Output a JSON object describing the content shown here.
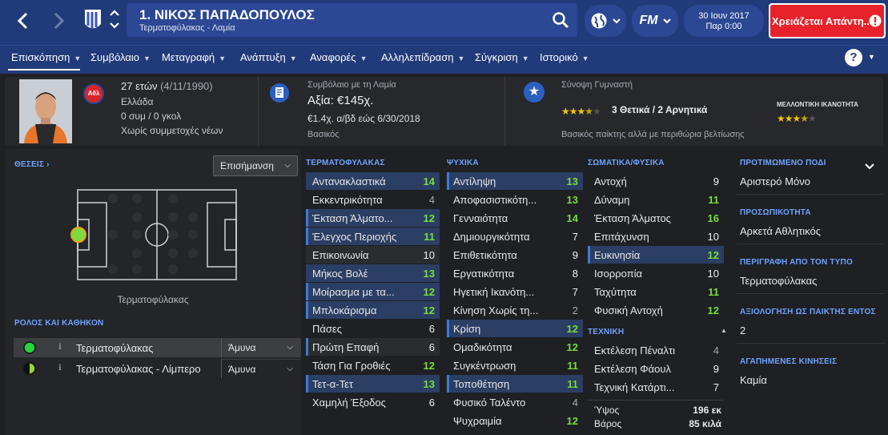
{
  "header": {
    "player_name": "1. ΝΙΚΟΣ ΠΑΠΑΔΟΠΟΥΛΟΣ",
    "subtitle": "Τερματοφύλακας - Λαμία",
    "date": "30 Ιουν 2017",
    "time": "Παρ 0:00",
    "alert": "Χρειάζεται Απάντη...",
    "fm": "FM"
  },
  "tabs": [
    "Επισκόπηση",
    "Συμβόλαιο",
    "Μεταγραφή",
    "Ανάπτυξη",
    "Αναφορές",
    "Αλληλεπίδραση",
    "Σύγκριση",
    "Ιστορικό"
  ],
  "summary": {
    "age": "27 ετών",
    "dob": "(4/11/1990)",
    "nation": "Ελλάδα",
    "caps": "0 συμ / 0 γκολ",
    "youth": "Χωρίς συμμετοχές νέων",
    "club_badge": "Αθλ",
    "contract_label": "Συμβόλαιο με τη Λαμία",
    "value": "Αξία: €145χ.",
    "wage": "€1.4χ. α/βδ εώς 6/30/2018",
    "contract_type": "Βασικός",
    "coach_label": "Σύνοψη Γυμναστή",
    "coach_summary": "3 Θετικά / 2 Αρνητικά",
    "coach_desc": "Βασικός παίκτης αλλά με περιθώρια βελτίωσης",
    "future_label": "ΜΕΛΛΟΝΤΙΚΗ ΙΚΑΝΟΤΗΤΑ",
    "current_stars": 3.5,
    "future_stars": 3.5
  },
  "positions": {
    "label": "ΘΕΣΕΙΣ",
    "dropdown": "Επισήμανση",
    "position_name": "Τερματοφύλακας"
  },
  "roles": {
    "label": "ΡΟΛΟΣ ΚΑΙ ΚΑΘΗΚΟΝ",
    "items": [
      {
        "name": "Τερματοφύλακας",
        "duty": "Άμυνα"
      },
      {
        "name": "Τερματοφύλακας - Λίμπερο",
        "duty": "Άμυνα"
      }
    ]
  },
  "gk": {
    "label": "ΤΕΡΜΑΤΟΦΥΛΑΚΑΣ",
    "items": [
      {
        "name": "Αντανακλαστικά",
        "value": "14"
      },
      {
        "name": "Εκκεντρικότητα",
        "value": "4"
      },
      {
        "name": "Έκταση Άλματο...",
        "value": "12"
      },
      {
        "name": "Έλεγχος Περιοχής",
        "value": "11"
      },
      {
        "name": "Επικοινωνία",
        "value": "10"
      },
      {
        "name": "Μήκος Βολέ",
        "value": "13"
      },
      {
        "name": "Μοίρασμα με τα...",
        "value": "12"
      },
      {
        "name": "Μπλοκάρισμα",
        "value": "12"
      },
      {
        "name": "Πάσες",
        "value": "6"
      },
      {
        "name": "Πρώτη Επαφή",
        "value": "6"
      },
      {
        "name": "Τάση Για Γροθιές",
        "value": "12"
      },
      {
        "name": "Τετ-α-Τετ",
        "value": "13"
      },
      {
        "name": "Χαμηλή Έξοδος",
        "value": "6"
      }
    ]
  },
  "mental": {
    "label": "ΨΥΧΙΚΑ",
    "items": [
      {
        "name": "Αντίληψη",
        "value": "13"
      },
      {
        "name": "Αποφασιστικότη...",
        "value": "13"
      },
      {
        "name": "Γενναιότητα",
        "value": "14"
      },
      {
        "name": "Δημιουργικότητα",
        "value": "7"
      },
      {
        "name": "Επιθετικότητα",
        "value": "9"
      },
      {
        "name": "Εργατικότητα",
        "value": "8"
      },
      {
        "name": "Ηγετική Ικανότη...",
        "value": "7"
      },
      {
        "name": "Κίνηση Χωρίς τη...",
        "value": "2"
      },
      {
        "name": "Κρίση",
        "value": "12"
      },
      {
        "name": "Ομαδικότητα",
        "value": "12"
      },
      {
        "name": "Συγκέντρωση",
        "value": "11"
      },
      {
        "name": "Τοποθέτηση",
        "value": "11"
      },
      {
        "name": "Φυσικό Ταλέντο",
        "value": "4"
      },
      {
        "name": "Ψυχραιμία",
        "value": "12"
      }
    ]
  },
  "physical": {
    "label": "ΣΩΜΑΤΙΚΑ/ΦΥΣΙΚΑ",
    "items": [
      {
        "name": "Αντοχή",
        "value": "9"
      },
      {
        "name": "Δύναμη",
        "value": "11"
      },
      {
        "name": "Έκταση Άλματος",
        "value": "16"
      },
      {
        "name": "Επιτάχυνση",
        "value": "10"
      },
      {
        "name": "Ευκινησία",
        "value": "12"
      },
      {
        "name": "Ισορροπία",
        "value": "10"
      },
      {
        "name": "Ταχύτητα",
        "value": "11"
      },
      {
        "name": "Φυσική Αντοχή",
        "value": "12"
      }
    ]
  },
  "technical": {
    "label": "ΤΕΧΝΙΚΗ",
    "items": [
      {
        "name": "Εκτέλεση Πέναλτι",
        "value": "4"
      },
      {
        "name": "Εκτέλεση Φάουλ",
        "value": "9"
      },
      {
        "name": "Τεχνική Κατάρτι...",
        "value": "7"
      }
    ]
  },
  "body": {
    "height_label": "Ύψος",
    "height": "196 εκ",
    "weight_label": "Βάρος",
    "weight": "85 κιλά"
  },
  "info": [
    {
      "label": "ΠΡΟΤΙΜΩΜΕΝΟ ΠΟΔΙ",
      "value": "Αριστερό Μόνο"
    },
    {
      "label": "ΠΡΟΣΩΠΙΚΟΤΗΤΑ",
      "value": "Αρκετά Αθλητικός"
    },
    {
      "label": "ΠΕΡΙΓΡΑΦΗ ΑΠΟ ΤΟΝ ΤΥΠΟ",
      "value": "Τερματοφύλακας"
    },
    {
      "label": "ΑΞΙΟΛΟΓΗΣΗ ΩΣ ΠΑΙΚΤΗΣ ΕΝΤΟΣ",
      "value": "2"
    },
    {
      "label": "ΑΓΑΠΗΜΕΝΕΣ ΚΙΝΗΣΕΙΣ",
      "value": "Καμία"
    }
  ],
  "colors": {
    "green": "#7bdc3f",
    "header": "#213a7a",
    "accent": "#6fa3ff",
    "alert": "#e8222a"
  }
}
